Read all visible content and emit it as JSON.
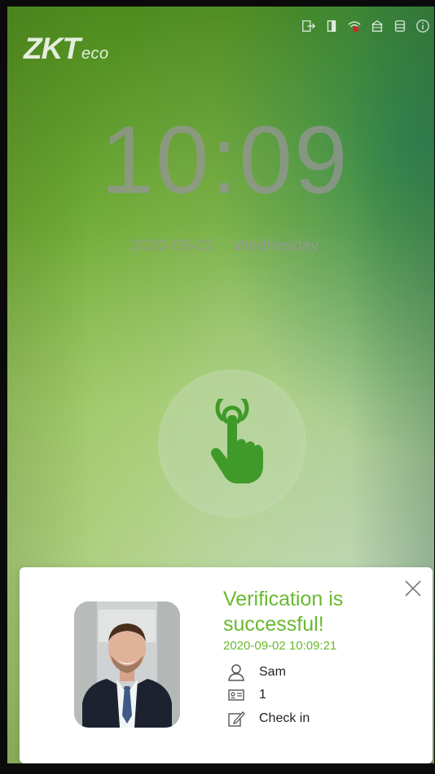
{
  "logo": {
    "main": "ZKT",
    "sub": "eco"
  },
  "status_icons": [
    {
      "name": "logout-icon"
    },
    {
      "name": "door-icon"
    },
    {
      "name": "wifi-disconnected-icon"
    },
    {
      "name": "network-icon"
    },
    {
      "name": "database-icon"
    },
    {
      "name": "info-icon"
    }
  ],
  "clock": {
    "time": "10:09",
    "date": "2020-09-02",
    "weekday": "Wednesday"
  },
  "touch_button": {
    "icon": "touch-hand-icon",
    "color": "#3f9a2a"
  },
  "verification_popup": {
    "headline": "Verification is successful!",
    "timestamp": "2020-09-02 10:09:21",
    "user_name": "Sam",
    "user_id": "1",
    "state": "Check in",
    "accent_color": "#6ab82f"
  }
}
